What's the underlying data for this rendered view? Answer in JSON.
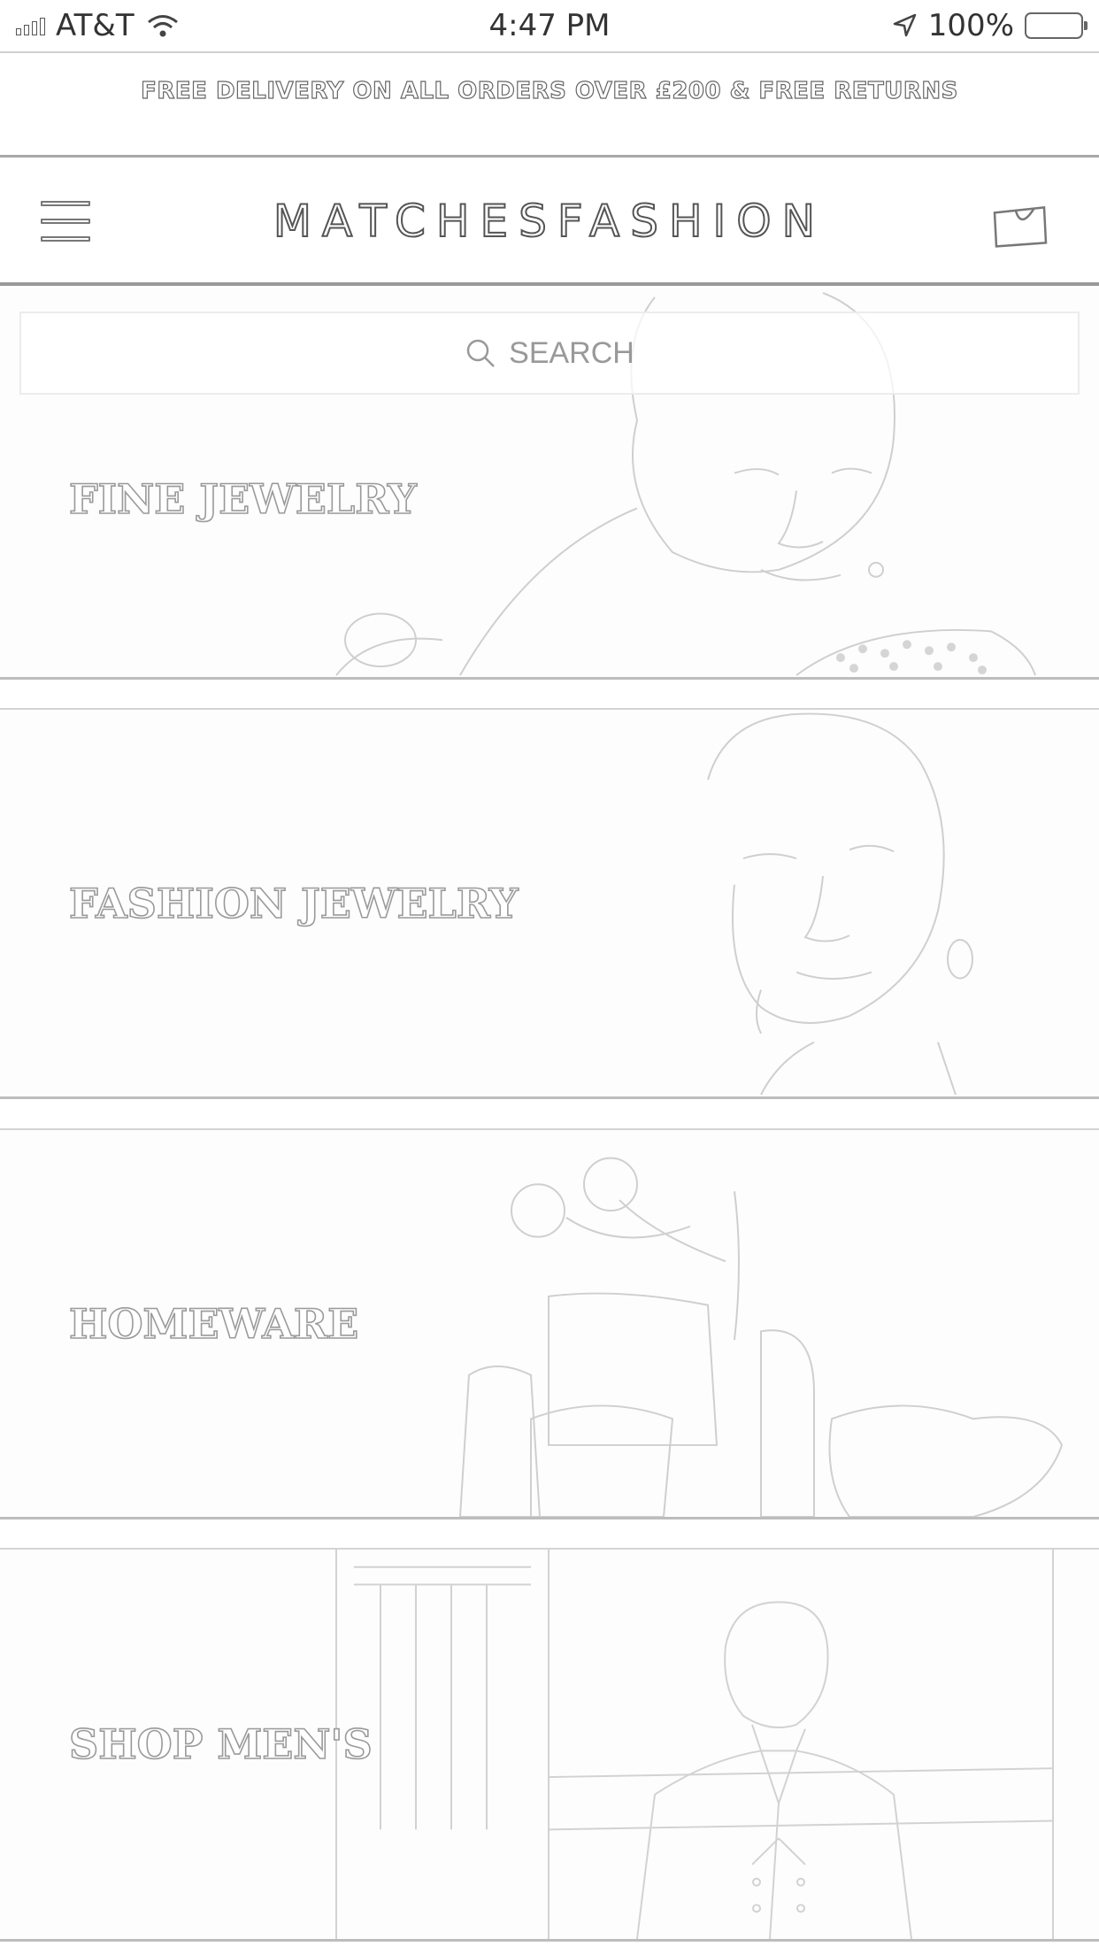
{
  "status_bar": {
    "carrier": "AT&T",
    "time": "4:47 PM",
    "battery": "100%"
  },
  "promo": {
    "text": "FREE DELIVERY ON ALL ORDERS OVER £200 & FREE RETURNS"
  },
  "header": {
    "logo": "MATCHESFASHION",
    "menu_icon": "hamburger-menu-icon",
    "bag_icon": "shopping-bag-icon"
  },
  "search": {
    "placeholder": "SEARCH",
    "icon": "search-icon"
  },
  "categories": [
    {
      "label": "FINE JEWELRY"
    },
    {
      "label": "FASHION JEWELRY"
    },
    {
      "label": "HOMEWARE"
    },
    {
      "label": "SHOP MEN'S"
    }
  ],
  "colors": {
    "background": "#ffffff",
    "line": "#9a9a9a"
  }
}
